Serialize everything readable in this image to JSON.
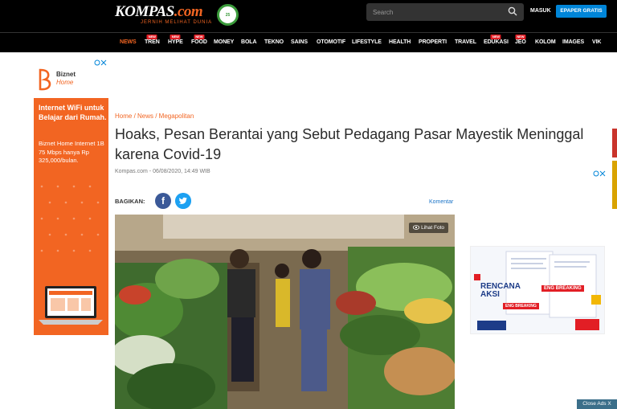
{
  "header": {
    "logo_text": "KOMPAS",
    "logo_suffix": ".com",
    "tagline": "JERNIH MELIHAT DUNIA",
    "search_placeholder": "Search",
    "login_label": "MASUK",
    "epaper_label": "EPAPER GRATIS"
  },
  "nav": {
    "items": [
      {
        "label": "NEWS",
        "active": true,
        "new": false
      },
      {
        "label": "TREN",
        "active": false,
        "new": true
      },
      {
        "label": "HYPE",
        "active": false,
        "new": true
      },
      {
        "label": "FOOD",
        "active": false,
        "new": true
      },
      {
        "label": "MONEY",
        "active": false,
        "new": false
      },
      {
        "label": "BOLA",
        "active": false,
        "new": false
      },
      {
        "label": "TEKNO",
        "active": false,
        "new": false
      },
      {
        "label": "SAINS",
        "active": false,
        "new": false
      },
      {
        "label": "OTOMOTIF",
        "active": false,
        "new": false
      },
      {
        "label": "LIFESTYLE",
        "active": false,
        "new": false
      },
      {
        "label": "HEALTH",
        "active": false,
        "new": false
      },
      {
        "label": "PROPERTI",
        "active": false,
        "new": false
      },
      {
        "label": "TRAVEL",
        "active": false,
        "new": false
      },
      {
        "label": "EDUKASI",
        "active": false,
        "new": true
      },
      {
        "label": "JEO",
        "active": false,
        "new": true
      },
      {
        "label": "KOLOM",
        "active": false,
        "new": false
      },
      {
        "label": "IMAGES",
        "active": false,
        "new": false
      },
      {
        "label": "VIK",
        "active": false,
        "new": false
      }
    ],
    "new_tag": "NEW"
  },
  "article": {
    "breadcrumb": "Home / News / Megapolitan",
    "title": "Hoaks, Pesan Berantai yang Sebut Pedagang Pasar Mayestik Meninggal karena Covid-19",
    "meta": "Kompas.com - 06/08/2020, 14:49 WIB",
    "share_label": "BAGIKAN:",
    "comment_label": "Komentar",
    "photo_button": "Lihat Foto"
  },
  "ad_left": {
    "brand": "Biznet",
    "brand_sub": "Home",
    "headline": "Internet WiFi untuk Belajar dari Rumah.",
    "body": "Biznet Home Internet 1B 75 Mbps hanya Rp 325,000/bulan."
  },
  "ad_right": {
    "text1": "RENCANA",
    "text2": "AKSI",
    "badge1": "ENG BREAKING",
    "badge2": "ENG BREAKING"
  },
  "close_ads": "Close Ads X",
  "colors": {
    "accent": "#f26522",
    "nav_bg": "#000000",
    "epaper": "#0085d8",
    "facebook": "#3b5998",
    "twitter": "#1da1f2"
  }
}
